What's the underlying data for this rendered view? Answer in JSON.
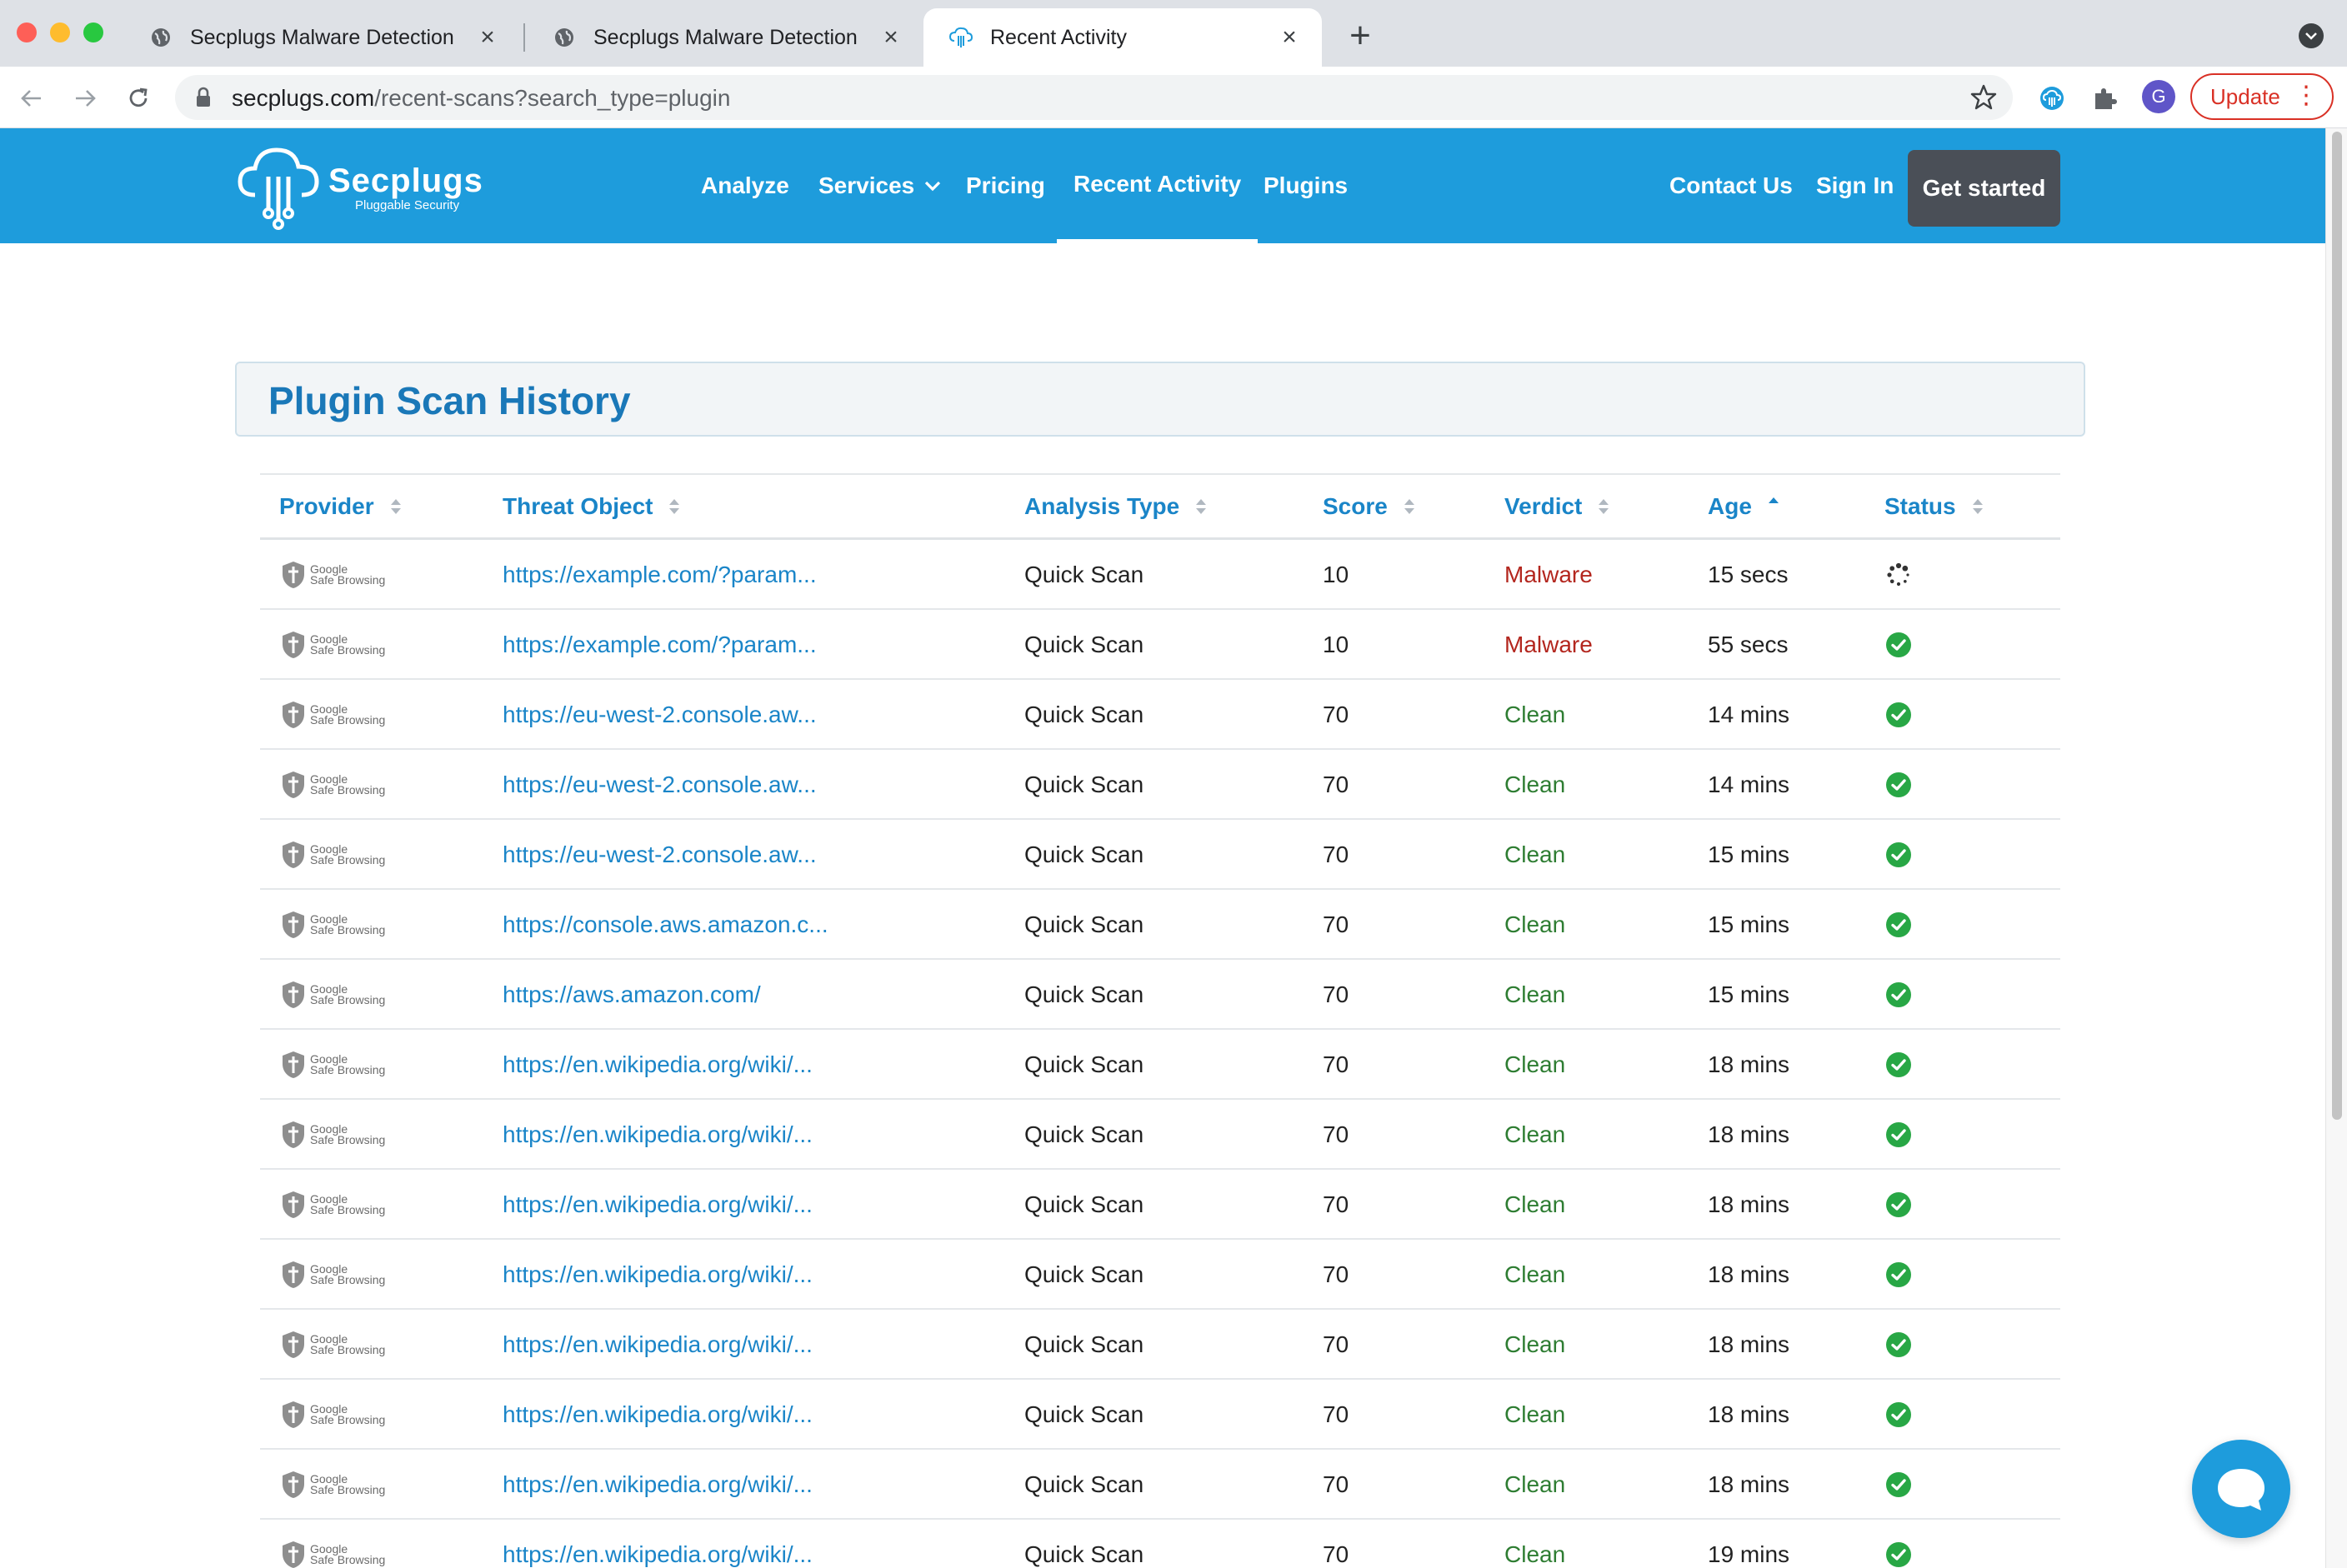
{
  "browser": {
    "tabs": [
      {
        "title": "Secplugs Malware Detection",
        "favicon": "globe-icon",
        "active": false
      },
      {
        "title": "Secplugs Malware Detection",
        "favicon": "globe-icon",
        "active": false
      },
      {
        "title": "Recent Activity",
        "favicon": "secplugs-cloud-icon",
        "active": true
      }
    ],
    "url_host": "secplugs.com",
    "url_path": "/recent-scans?search_type=plugin",
    "profile_initial": "G",
    "update_label": "Update"
  },
  "site": {
    "logo_name": "Secplugs",
    "logo_tagline": "Pluggable Security",
    "nav": {
      "analyze": "Analyze",
      "services": "Services",
      "pricing": "Pricing",
      "recent_activity": "Recent Activity",
      "plugins": "Plugins",
      "contact": "Contact Us",
      "signin": "Sign In",
      "get_started": "Get started"
    },
    "brand_color": "#1e9cdc"
  },
  "page": {
    "title": "Plugin Scan History"
  },
  "table": {
    "columns": [
      "Provider",
      "Threat Object",
      "Analysis Type",
      "Score",
      "Verdict",
      "Age",
      "Status"
    ],
    "sorted_column": "Age",
    "sort_direction": "ascending",
    "provider_label_1": "Google",
    "provider_label_2": "Safe Browsing",
    "rows": [
      {
        "threat": "https://example.com/?param...",
        "analysis": "Quick Scan",
        "score": "10",
        "verdict": "Malware",
        "age": "15 secs",
        "status": "loading"
      },
      {
        "threat": "https://example.com/?param...",
        "analysis": "Quick Scan",
        "score": "10",
        "verdict": "Malware",
        "age": "55 secs",
        "status": "done"
      },
      {
        "threat": "https://eu-west-2.console.aw...",
        "analysis": "Quick Scan",
        "score": "70",
        "verdict": "Clean",
        "age": "14 mins",
        "status": "done"
      },
      {
        "threat": "https://eu-west-2.console.aw...",
        "analysis": "Quick Scan",
        "score": "70",
        "verdict": "Clean",
        "age": "14 mins",
        "status": "done"
      },
      {
        "threat": "https://eu-west-2.console.aw...",
        "analysis": "Quick Scan",
        "score": "70",
        "verdict": "Clean",
        "age": "15 mins",
        "status": "done"
      },
      {
        "threat": "https://console.aws.amazon.c...",
        "analysis": "Quick Scan",
        "score": "70",
        "verdict": "Clean",
        "age": "15 mins",
        "status": "done"
      },
      {
        "threat": "https://aws.amazon.com/",
        "analysis": "Quick Scan",
        "score": "70",
        "verdict": "Clean",
        "age": "15 mins",
        "status": "done"
      },
      {
        "threat": "https://en.wikipedia.org/wiki/...",
        "analysis": "Quick Scan",
        "score": "70",
        "verdict": "Clean",
        "age": "18 mins",
        "status": "done"
      },
      {
        "threat": "https://en.wikipedia.org/wiki/...",
        "analysis": "Quick Scan",
        "score": "70",
        "verdict": "Clean",
        "age": "18 mins",
        "status": "done"
      },
      {
        "threat": "https://en.wikipedia.org/wiki/...",
        "analysis": "Quick Scan",
        "score": "70",
        "verdict": "Clean",
        "age": "18 mins",
        "status": "done"
      },
      {
        "threat": "https://en.wikipedia.org/wiki/...",
        "analysis": "Quick Scan",
        "score": "70",
        "verdict": "Clean",
        "age": "18 mins",
        "status": "done"
      },
      {
        "threat": "https://en.wikipedia.org/wiki/...",
        "analysis": "Quick Scan",
        "score": "70",
        "verdict": "Clean",
        "age": "18 mins",
        "status": "done"
      },
      {
        "threat": "https://en.wikipedia.org/wiki/...",
        "analysis": "Quick Scan",
        "score": "70",
        "verdict": "Clean",
        "age": "18 mins",
        "status": "done"
      },
      {
        "threat": "https://en.wikipedia.org/wiki/...",
        "analysis": "Quick Scan",
        "score": "70",
        "verdict": "Clean",
        "age": "18 mins",
        "status": "done"
      },
      {
        "threat": "https://en.wikipedia.org/wiki/...",
        "analysis": "Quick Scan",
        "score": "70",
        "verdict": "Clean",
        "age": "19 mins",
        "status": "done"
      }
    ],
    "colors": {
      "malware": "#b3261e",
      "clean": "#2e7d32",
      "link": "#1a85c8",
      "status_ok": "#28a745"
    }
  },
  "chat": {
    "icon": "chat-bubble-icon"
  }
}
